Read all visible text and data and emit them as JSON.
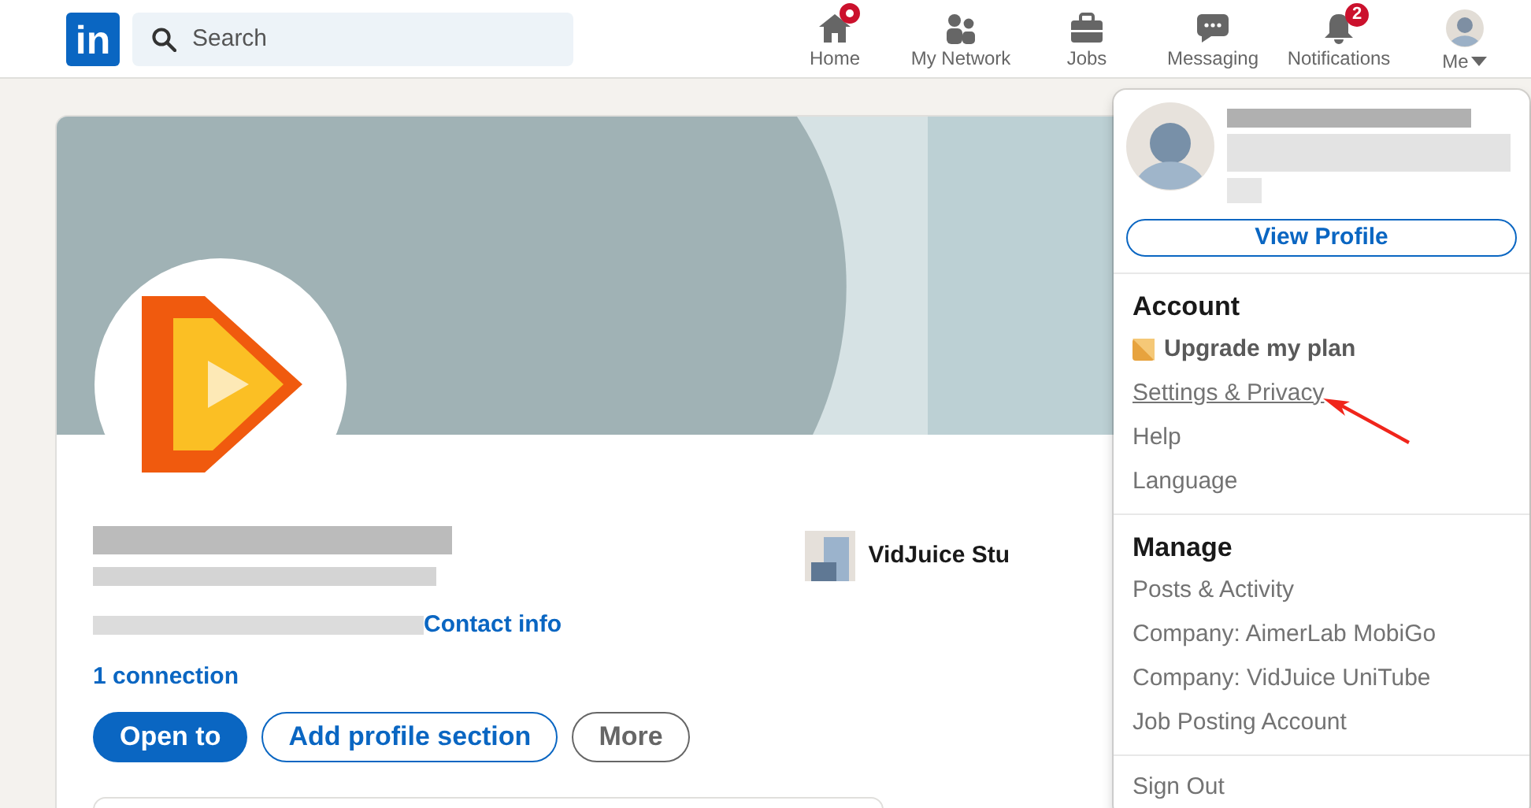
{
  "nav": {
    "logo": "in",
    "search": {
      "placeholder": "Search"
    },
    "items": [
      {
        "label": "Home",
        "kind": "home",
        "dot": true
      },
      {
        "label": "My Network",
        "kind": "network",
        "dot": false
      },
      {
        "label": "Jobs",
        "kind": "jobs",
        "dot": false
      },
      {
        "label": "Messaging",
        "kind": "messaging",
        "dot": false
      },
      {
        "label": "Notifications",
        "kind": "bell",
        "dot": false,
        "badge": "2"
      },
      {
        "label": "Me",
        "kind": "avatar",
        "dot": false
      }
    ]
  },
  "profile": {
    "company": "VidJuice Stu",
    "contact_info": "Contact info",
    "connections": "1 connection",
    "buttons": [
      {
        "label": "Open to",
        "kind": "primary"
      },
      {
        "label": "Add profile section",
        "kind": "outline"
      },
      {
        "label": "More",
        "kind": "secondary"
      }
    ]
  },
  "menu": {
    "view_profile": "View Profile",
    "sections": [
      {
        "title": "Account",
        "items": [
          {
            "label": "Upgrade my plan",
            "kind": "premium",
            "hovered": false
          },
          {
            "label": "Settings & Privacy",
            "kind": "link",
            "hovered": true
          },
          {
            "label": "Help",
            "kind": "link",
            "hovered": false
          },
          {
            "label": "Language",
            "kind": "link",
            "hovered": false
          }
        ]
      },
      {
        "title": "Manage",
        "items": [
          {
            "label": "Posts & Activity",
            "kind": "link",
            "hovered": false
          },
          {
            "label": "Company: AimerLab MobiGo",
            "kind": "link",
            "hovered": false
          },
          {
            "label": "Company: VidJuice UniTube",
            "kind": "link",
            "hovered": false
          },
          {
            "label": "Job Posting Account",
            "kind": "link",
            "hovered": false
          }
        ]
      }
    ],
    "sign_out": "Sign Out"
  }
}
